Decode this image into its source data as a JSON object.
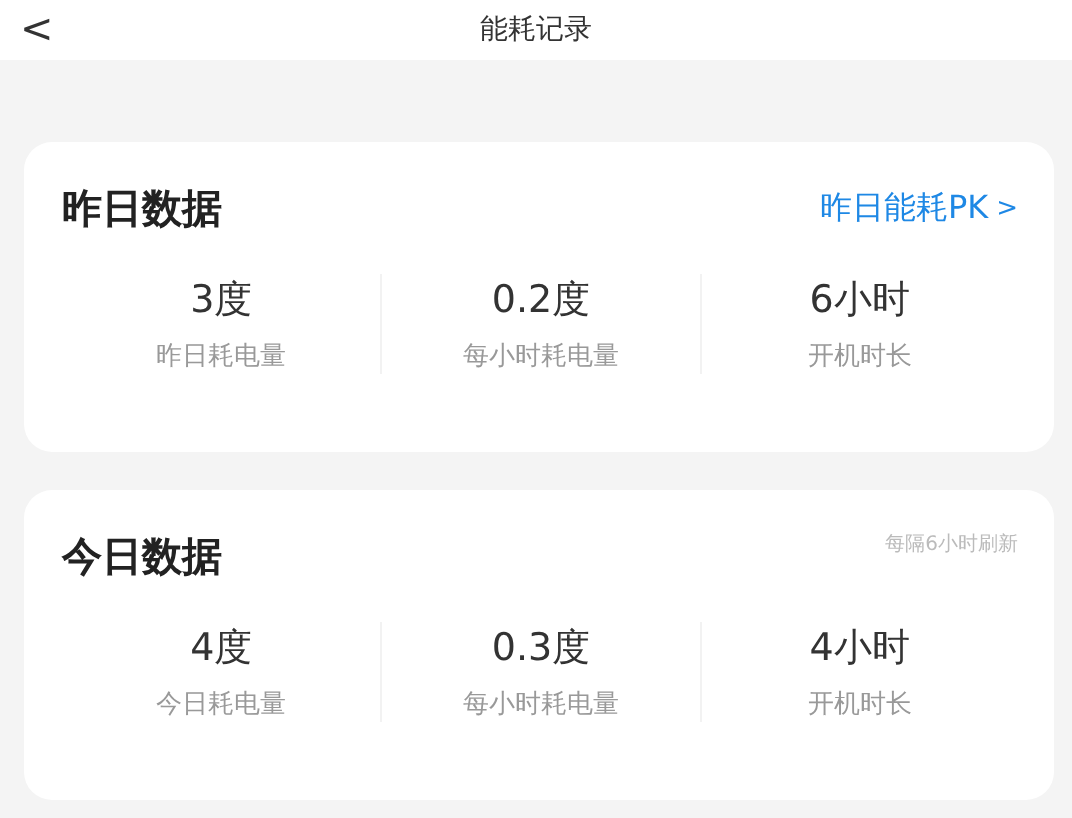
{
  "header": {
    "back": "<",
    "title": "能耗记录"
  },
  "cards": [
    {
      "title": "昨日数据",
      "action": {
        "kind": "link",
        "text": "昨日能耗PK",
        "chevron": ">"
      },
      "stats": [
        {
          "value": "3度",
          "label": "昨日耗电量"
        },
        {
          "value": "0.2度",
          "label": "每小时耗电量"
        },
        {
          "value": "6小时",
          "label": "开机时长"
        }
      ]
    },
    {
      "title": "今日数据",
      "action": {
        "kind": "note",
        "text": "每隔6小时刷新"
      },
      "stats": [
        {
          "value": "4度",
          "label": "今日耗电量"
        },
        {
          "value": "0.3度",
          "label": "每小时耗电量"
        },
        {
          "value": "4小时",
          "label": "开机时长"
        }
      ]
    }
  ]
}
